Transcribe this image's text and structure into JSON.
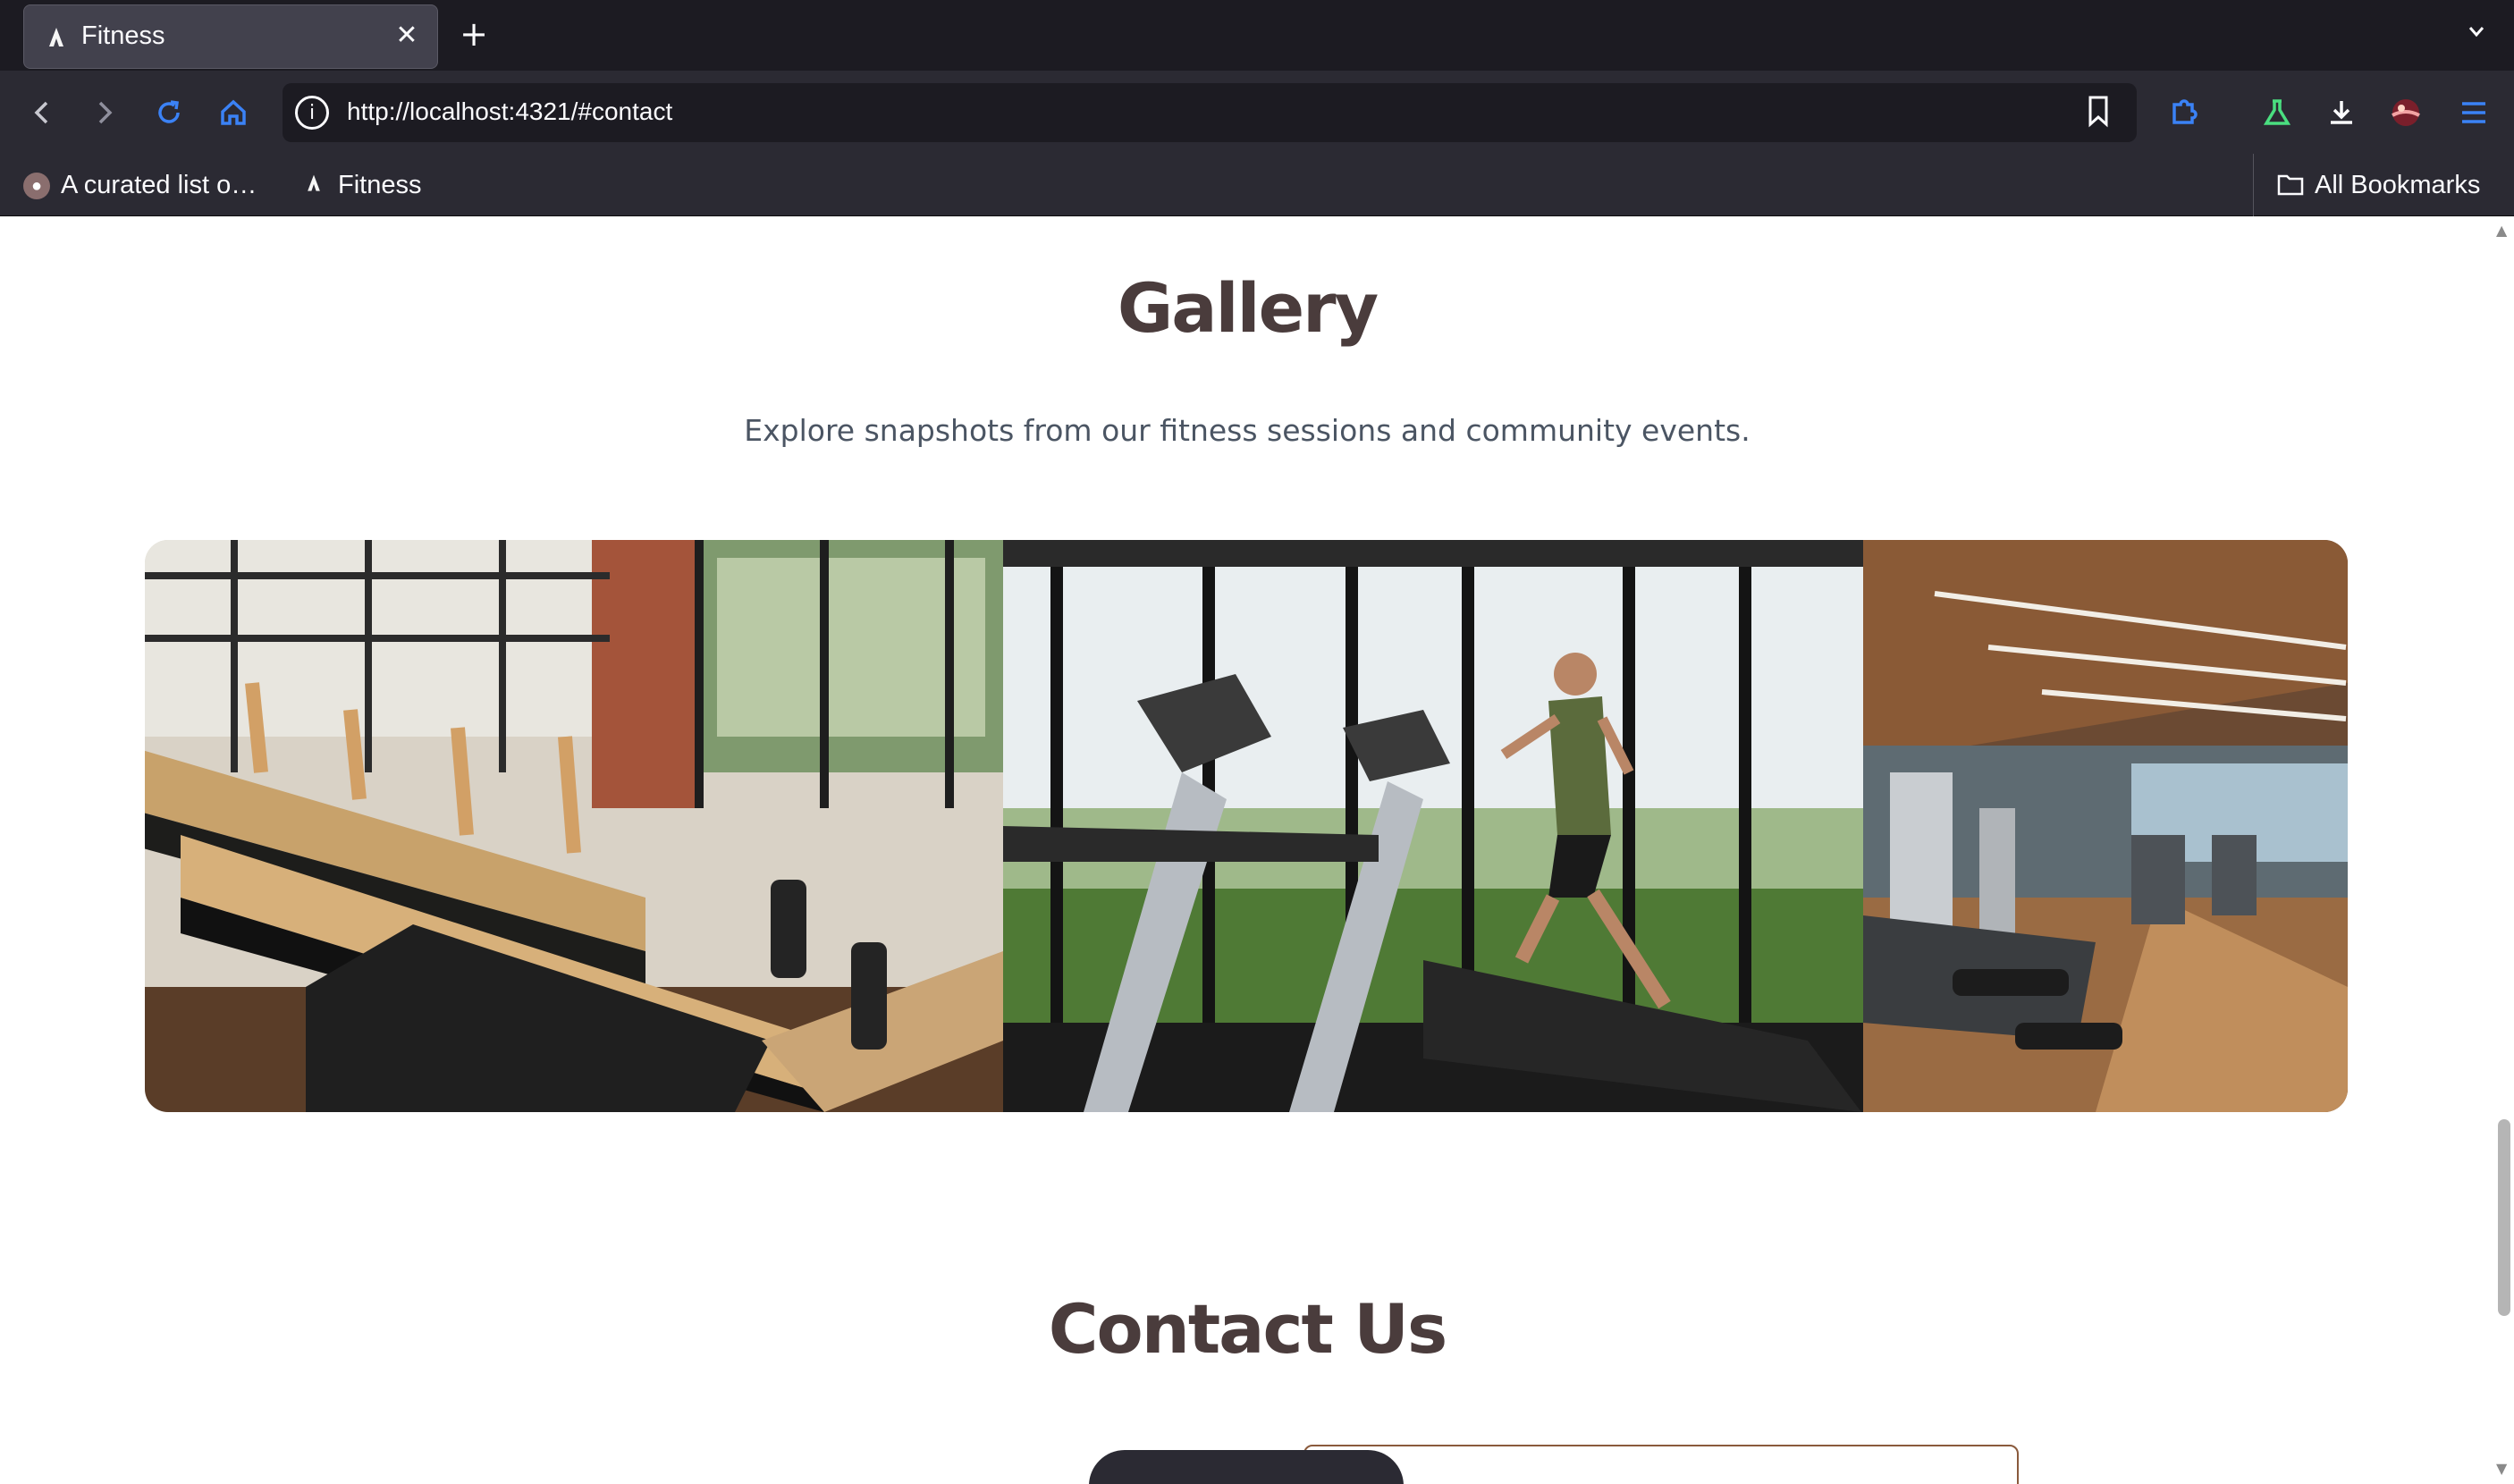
{
  "browser": {
    "tab": {
      "title": "Fitness",
      "close_glyph": "✕"
    },
    "new_tab_glyph": "+",
    "tab_list_glyph": "⌄",
    "nav": {
      "back": "‹",
      "forward": "›",
      "reload": "↻",
      "home": "⌂"
    },
    "url": "http://localhost:4321/#contact",
    "bookmarks": [
      {
        "label": "A curated list o…",
        "icon": "globe-icon"
      },
      {
        "label": "Fitness",
        "icon": "fitness-favicon-icon"
      }
    ],
    "all_bookmarks": "All Bookmarks",
    "toolbar_icons": [
      "bookmark-star-icon",
      "extensions-icon",
      "labs-flask-icon",
      "downloads-icon",
      "account-avatar-icon",
      "menu-icon"
    ]
  },
  "page": {
    "gallery": {
      "title": "Gallery",
      "subtitle": "Explore snapshots from our fitness sessions and community events.",
      "photos": [
        "pilates-reformers-photo",
        "treadmill-runner-photo",
        "gym-floor-photo"
      ]
    },
    "contact": {
      "title": "Contact Us"
    }
  },
  "colors": {
    "heading": "#4a3c3c",
    "subtitle": "#4b5563",
    "chrome_dark": "#1c1b22",
    "chrome": "#2b2a33",
    "accent_blue": "#3b82f6"
  }
}
